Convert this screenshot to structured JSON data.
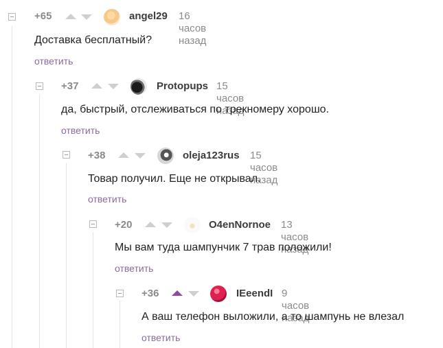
{
  "comments": [
    {
      "rating": "+65",
      "username": "angel29",
      "time": "16 часов назад",
      "text": "Доставка бесплатный?",
      "reply": "ответить"
    },
    {
      "rating": "+37",
      "username": "Protopups",
      "time": "15 часов назад",
      "text": "да, быстрый, отслеживаться по трекномеру хорошо.",
      "reply": "ответить"
    },
    {
      "rating": "+38",
      "username": "oleja123rus",
      "time": "15 часов назад",
      "text": "Товар получил. Еще не открывал.",
      "reply": "ответить"
    },
    {
      "rating": "+20",
      "username": "O4enNornoe",
      "time": "13 часов назад",
      "text": "Мы вам туда шампунчик  7 трав положили!",
      "reply": "ответить"
    },
    {
      "rating": "+36",
      "username": "IEeendI",
      "time": "9 часов назад",
      "text": "А ваш телефон выложили, а то шампунь не влезал",
      "reply": "ответить"
    }
  ],
  "colors": {
    "upvote_active": "#8a4e9a",
    "reply_link": "#8a6aa0",
    "arrow_inactive": "#cfcfcf"
  }
}
